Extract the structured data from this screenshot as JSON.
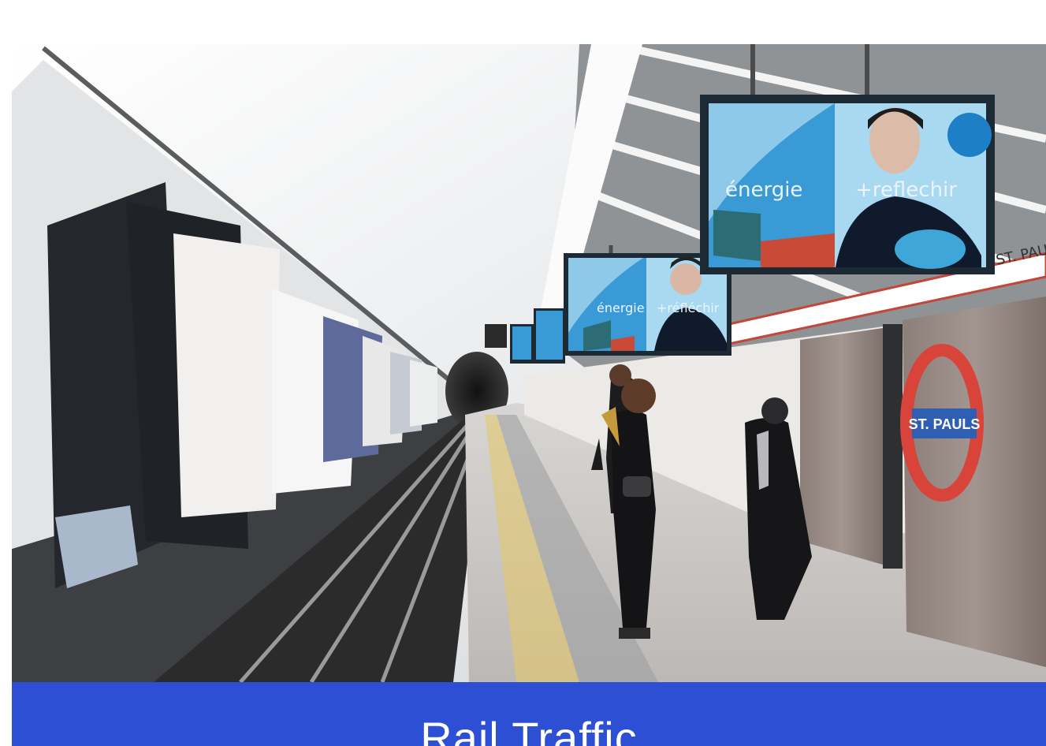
{
  "caption": {
    "title": "Rail Traffic"
  },
  "screen_large": {
    "word_left": "énergie",
    "word_right": "+reflechir"
  },
  "screen_small": {
    "word_left": "énergie",
    "word_right": "+réfléchir"
  },
  "station_sign": {
    "label": "ST. PAULS"
  },
  "wall_band": {
    "label": "ST. PAULS"
  },
  "colors": {
    "caption_bar": "#2d4fd3",
    "roundel_ring": "#d8443a",
    "roundel_bar": "#2f5fb3",
    "screen_blue": "#3a9ad6",
    "screen_frame": "#1e2a33"
  }
}
